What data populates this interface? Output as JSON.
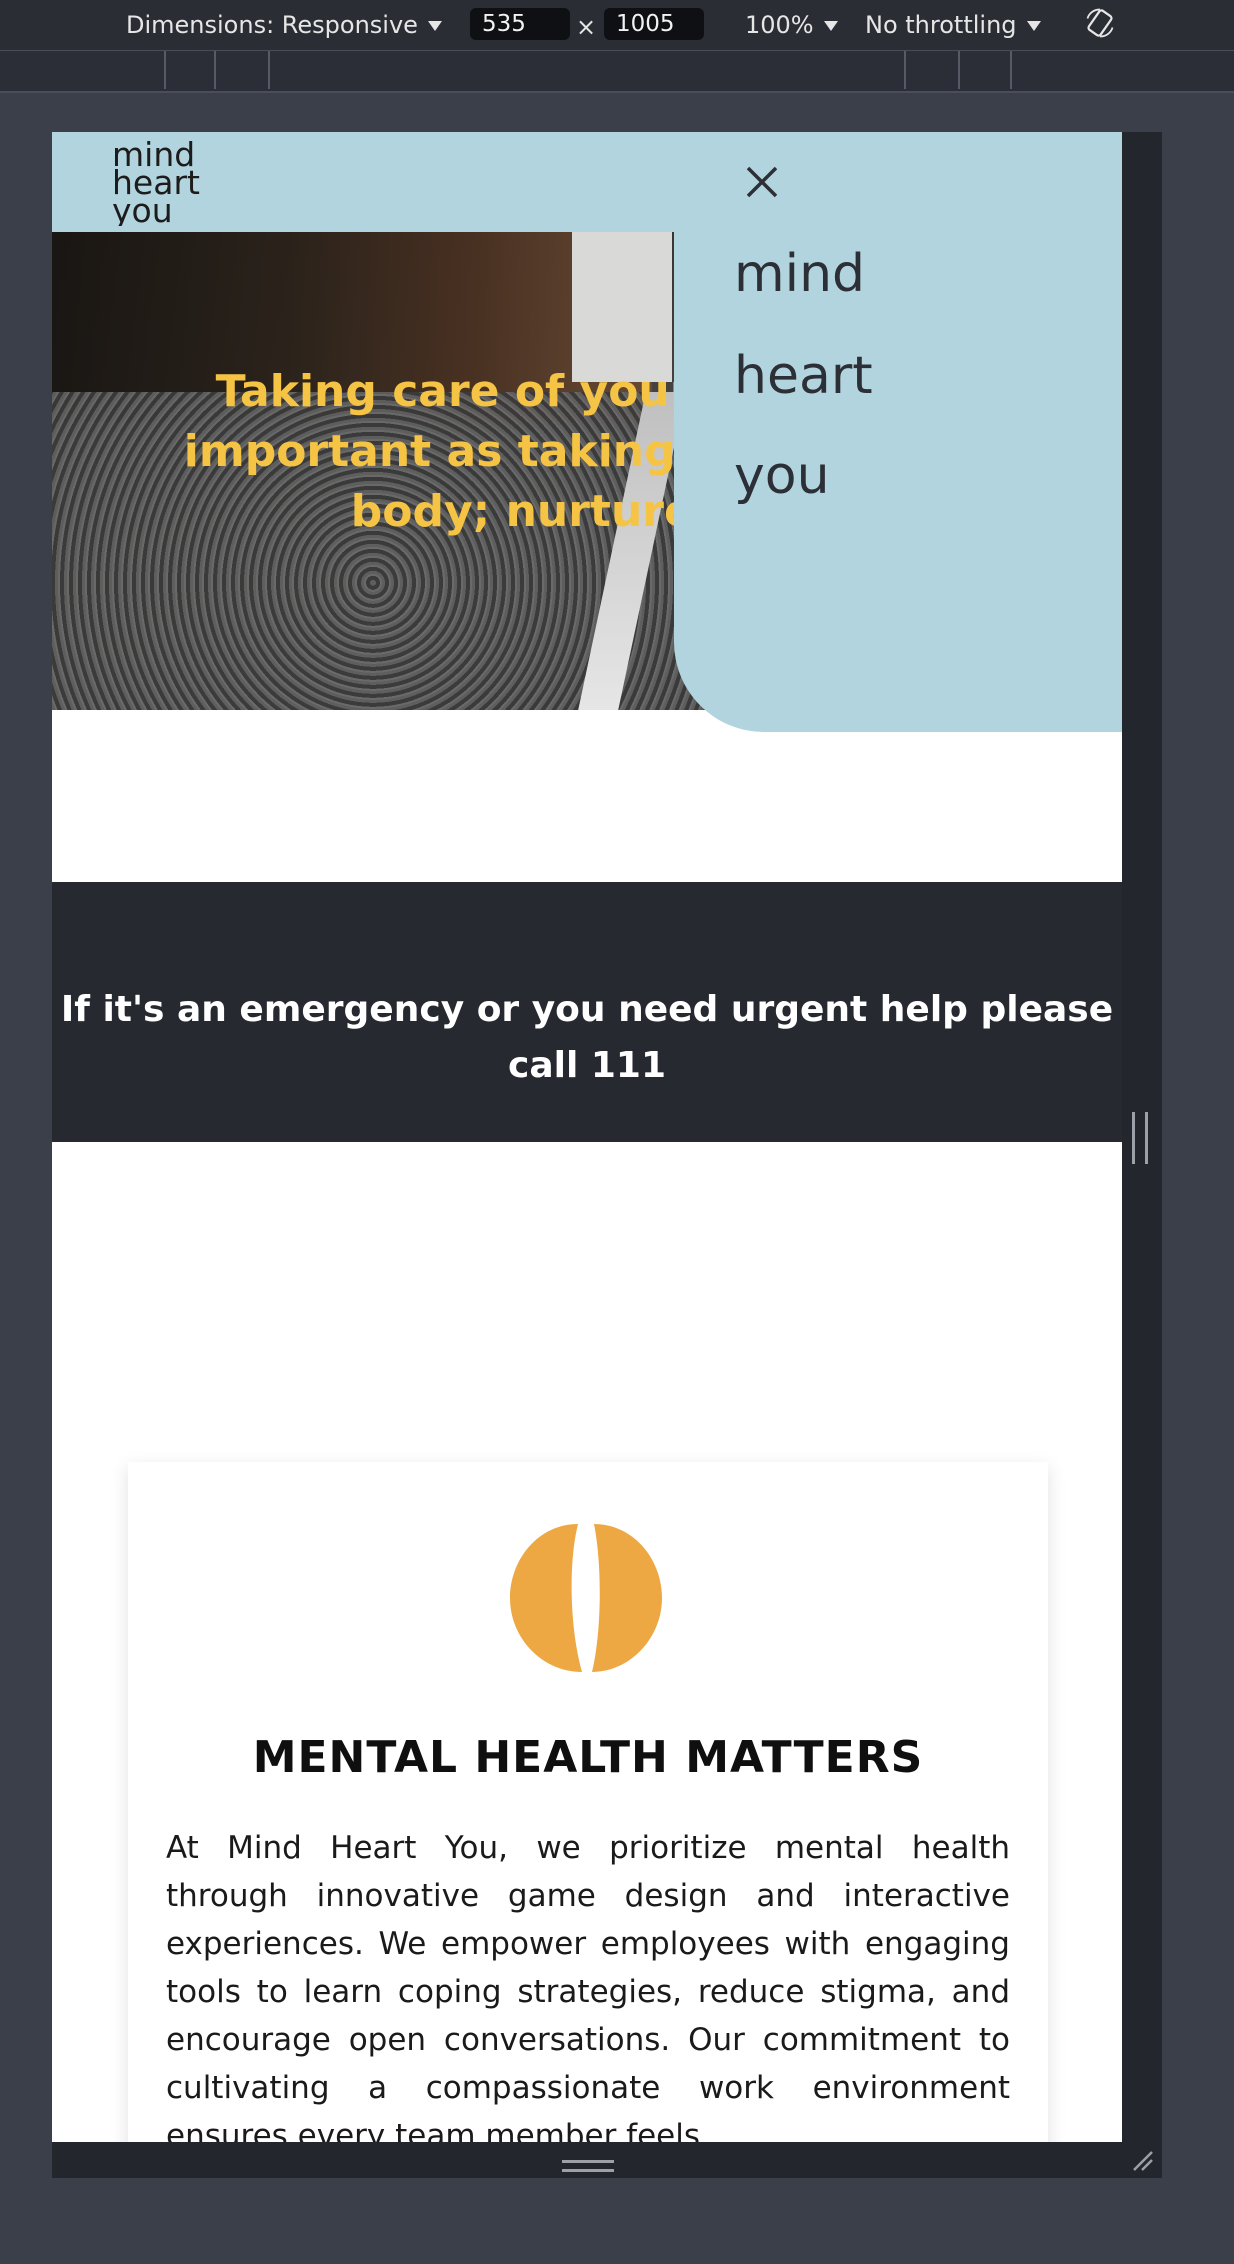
{
  "devtools": {
    "dimensions_label": "Dimensions: Responsive",
    "width_value": "535",
    "times": "×",
    "height_value": "1005",
    "zoom": "100%",
    "throttling": "No throttling"
  },
  "site": {
    "logo_text": [
      "mind",
      "heart",
      "you"
    ],
    "hero_title": "Taking care of your mind is as important as taking care of your body; nurture both",
    "emergency_text": "If it's an emergency or you need urgent help please call 111",
    "card": {
      "title": "MENTAL HEALTH MATTERS",
      "body": "At Mind Heart You, we prioritize mental health through innovative game design and interactive experiences. We empower employees with engaging tools to learn coping strategies, reduce stigma, and encourage open conversations. Our commitment to cultivating a compassionate work environment ensures every team member feels"
    },
    "menu": {
      "items": [
        {
          "label": "mind"
        },
        {
          "label": "heart"
        },
        {
          "label": "you"
        }
      ]
    }
  },
  "colors": {
    "header_bg": "#b2d4de",
    "hero_text": "#f6c445",
    "emergency_bg": "#262930",
    "brain": "#eea843"
  },
  "icons": [
    "dropdown-caret-icon",
    "rotate-icon",
    "close-icon",
    "brain-icon",
    "resize-grip-icon"
  ]
}
